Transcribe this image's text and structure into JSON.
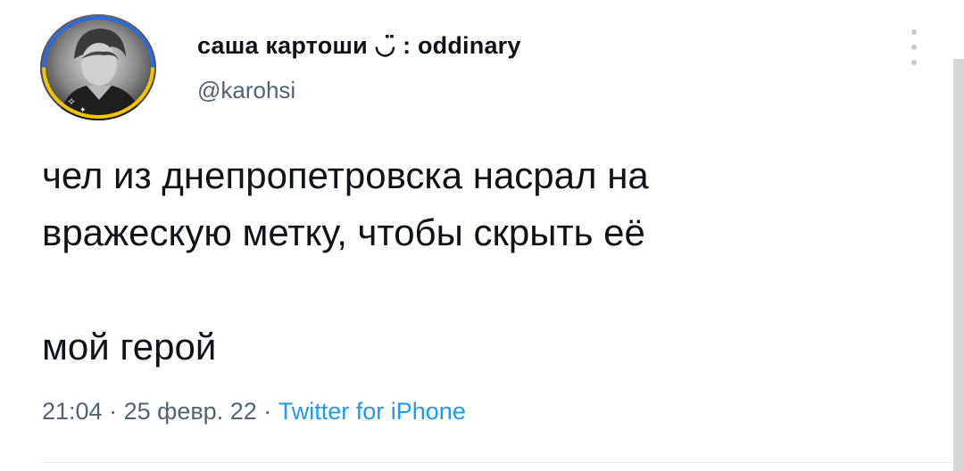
{
  "user": {
    "display_name": "саша картоши ◡̈ : oddinary",
    "handle": "@karohsi"
  },
  "tweet": {
    "line1": "чел из днепропетровска насрал на",
    "line2": "вражескую метку, чтобы скрыть её",
    "line3": "мой герой"
  },
  "meta": {
    "time": "21:04",
    "sep1": " · ",
    "date": "25 февр. 22",
    "sep2": " · ",
    "source": "Twitter for iPhone"
  },
  "icons": {
    "more": "more-vertical-icon",
    "avatar": "profile-photo"
  },
  "colors": {
    "text": "#0f1419",
    "secondary": "#536471",
    "link": "#1d9bf0",
    "avatar_ring_top": "#2f6bd6",
    "avatar_ring_bottom": "#f2c500"
  }
}
